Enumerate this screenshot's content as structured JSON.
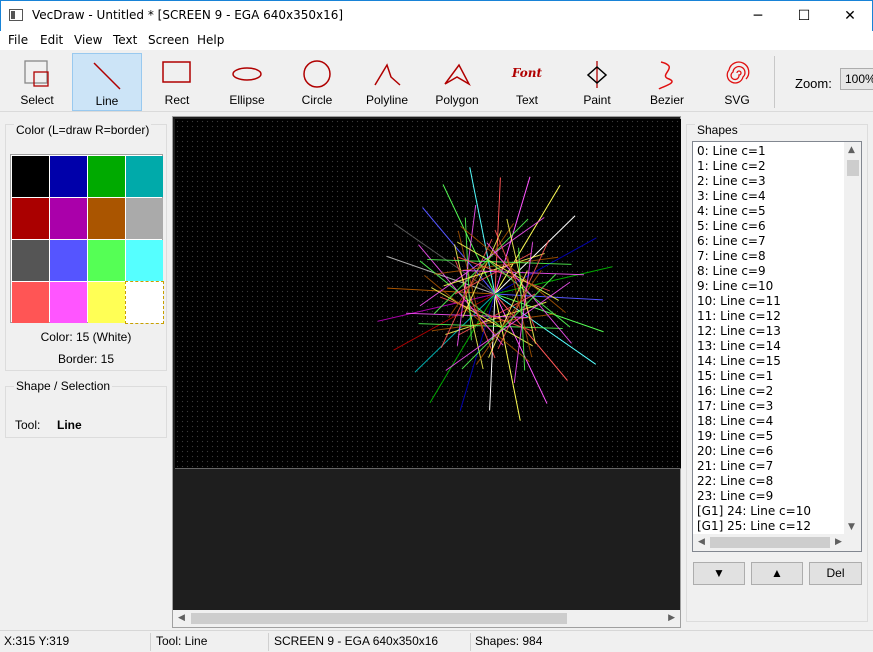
{
  "window": {
    "title": "VecDraw - Untitled * [SCREEN 9 - EGA 640x350x16]",
    "minimize_glyph": "─",
    "maximize_glyph": "☐",
    "close_glyph": "✕"
  },
  "menu": [
    "File",
    "Edit",
    "View",
    "Text",
    "Screen",
    "Help"
  ],
  "toolbar": {
    "tools": [
      {
        "label": "Select",
        "icon": "select-icon"
      },
      {
        "label": "Line",
        "icon": "line-icon",
        "active": true
      },
      {
        "label": "Rect",
        "icon": "rect-icon"
      },
      {
        "label": "Ellipse",
        "icon": "ellipse-icon"
      },
      {
        "label": "Circle",
        "icon": "circle-icon"
      },
      {
        "label": "Polyline",
        "icon": "polyline-icon"
      },
      {
        "label": "Polygon",
        "icon": "polygon-icon"
      },
      {
        "label": "Text",
        "icon": "text-tool-icon",
        "icon_text": "Font"
      },
      {
        "label": "Paint",
        "icon": "paint-icon"
      },
      {
        "label": "Bezier",
        "icon": "bezier-icon"
      },
      {
        "label": "SVG",
        "icon": "svg-spiral-icon"
      }
    ],
    "zoom_label": "Zoom:",
    "zoom_value": "100%"
  },
  "color_panel": {
    "title": "Color (L=draw R=border)",
    "palette": [
      "#000000",
      "#0000aa",
      "#00aa00",
      "#00aaaa",
      "#aa0000",
      "#aa00aa",
      "#aa5500",
      "#aaaaaa",
      "#555555",
      "#5555ff",
      "#55ff55",
      "#55ffff",
      "#ff5555",
      "#ff55ff",
      "#ffff55",
      "#ffffff"
    ],
    "color_text": "Color: 15 (White)",
    "border_text": "Border: 15"
  },
  "shape_panel": {
    "title": "Shape / Selection",
    "tool_label": "Tool:",
    "tool_value": "Line"
  },
  "shapes_panel": {
    "title": "Shapes",
    "items": [
      "0: Line  c=1",
      "1: Line  c=2",
      "2: Line  c=3",
      "3: Line  c=4",
      "4: Line  c=5",
      "5: Line  c=6",
      "6: Line  c=7",
      "7: Line  c=8",
      "8: Line  c=9",
      "9: Line  c=10",
      "10: Line  c=11",
      "11: Line  c=12",
      "12: Line  c=13",
      "13: Line  c=14",
      "14: Line  c=15",
      "15: Line  c=1",
      "16: Line  c=2",
      "17: Line  c=3",
      "18: Line  c=4",
      "19: Line  c=5",
      "20: Line  c=6",
      "21: Line  c=7",
      "22: Line  c=8",
      "23: Line  c=9",
      "[G1] 24: Line  c=10",
      "[G1] 25: Line  c=12"
    ],
    "buttons": {
      "down": "▼",
      "up": "▲",
      "delete": "Del"
    }
  },
  "status": {
    "coords": "X:315 Y:319",
    "tool": "Tool: Line",
    "screen": "SCREEN 9 - EGA 640x350x16",
    "shapes": "Shapes: 984"
  }
}
